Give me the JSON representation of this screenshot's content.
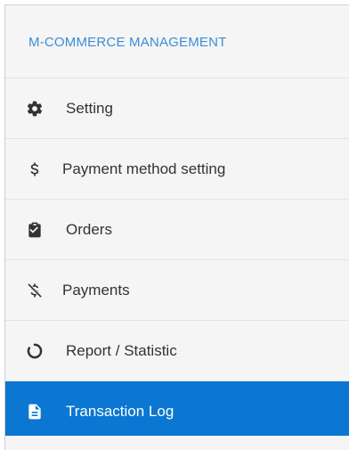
{
  "sidebar": {
    "title": "M-COMMERCE MANAGEMENT",
    "items": [
      {
        "label": "Setting",
        "icon": "gear-icon",
        "active": false
      },
      {
        "label": "Payment method setting",
        "icon": "dollar-icon",
        "active": false
      },
      {
        "label": "Orders",
        "icon": "clipboard-check-icon",
        "active": false
      },
      {
        "label": "Payments",
        "icon": "dollar-slash-icon",
        "active": false
      },
      {
        "label": "Report / Statistic",
        "icon": "circle-notch-icon",
        "active": false
      },
      {
        "label": "Transaction Log",
        "icon": "file-text-icon",
        "active": true
      }
    ]
  },
  "colors": {
    "title": "#3b8ed8",
    "active_background": "#0b77d2",
    "panel_background": "#f5f5f5",
    "text": "#333333"
  }
}
